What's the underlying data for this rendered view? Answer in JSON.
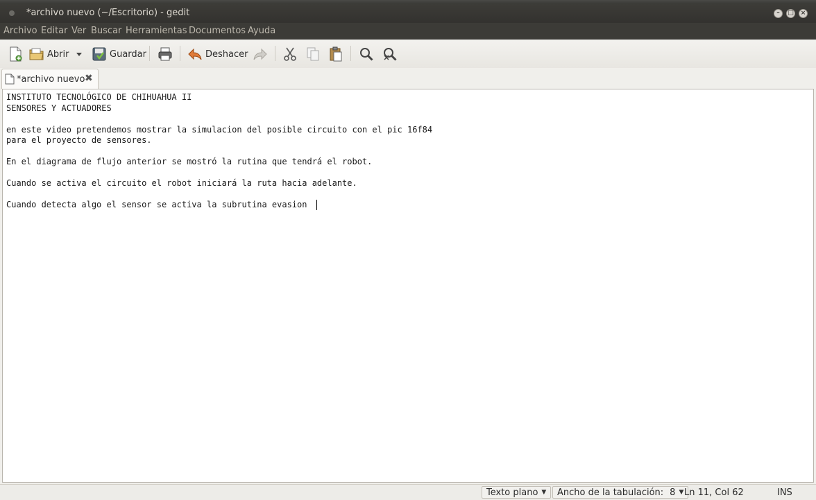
{
  "window": {
    "title": "*archivo nuevo (~/Escritorio) - gedit",
    "minimize_glyph": "–",
    "maximize_glyph": "□",
    "close_glyph": "×"
  },
  "menu": [
    "Archivo",
    "Editar",
    "Ver",
    "Buscar",
    "Herramientas",
    "Documentos",
    "Ayuda"
  ],
  "toolbar": {
    "open_label": "Abrir",
    "save_label": "Guardar",
    "undo_label": "Deshacer"
  },
  "tab": {
    "label": "*archivo nuevo"
  },
  "document": {
    "lines": [
      "INSTITUTO TECNOLÓGICO DE CHIHUAHUA II",
      "SENSORES Y ACTUADORES",
      "",
      "en este video pretendemos mostrar la simulacion del posible circuito con el pic 16f84",
      "para el proyecto de sensores.",
      "",
      "En el diagrama de flujo anterior se mostró la rutina que tendrá el robot.",
      "",
      "Cuando se activa el circuito el robot iniciará la ruta hacia adelante.",
      "",
      "Cuando detecta algo el sensor se activa la subrutina evasion "
    ]
  },
  "status": {
    "language": "Texto plano",
    "tab_width_label": "Ancho de la tabulación:",
    "tab_width_value": "8",
    "position": "Ln 11, Col 62",
    "mode": "INS"
  }
}
